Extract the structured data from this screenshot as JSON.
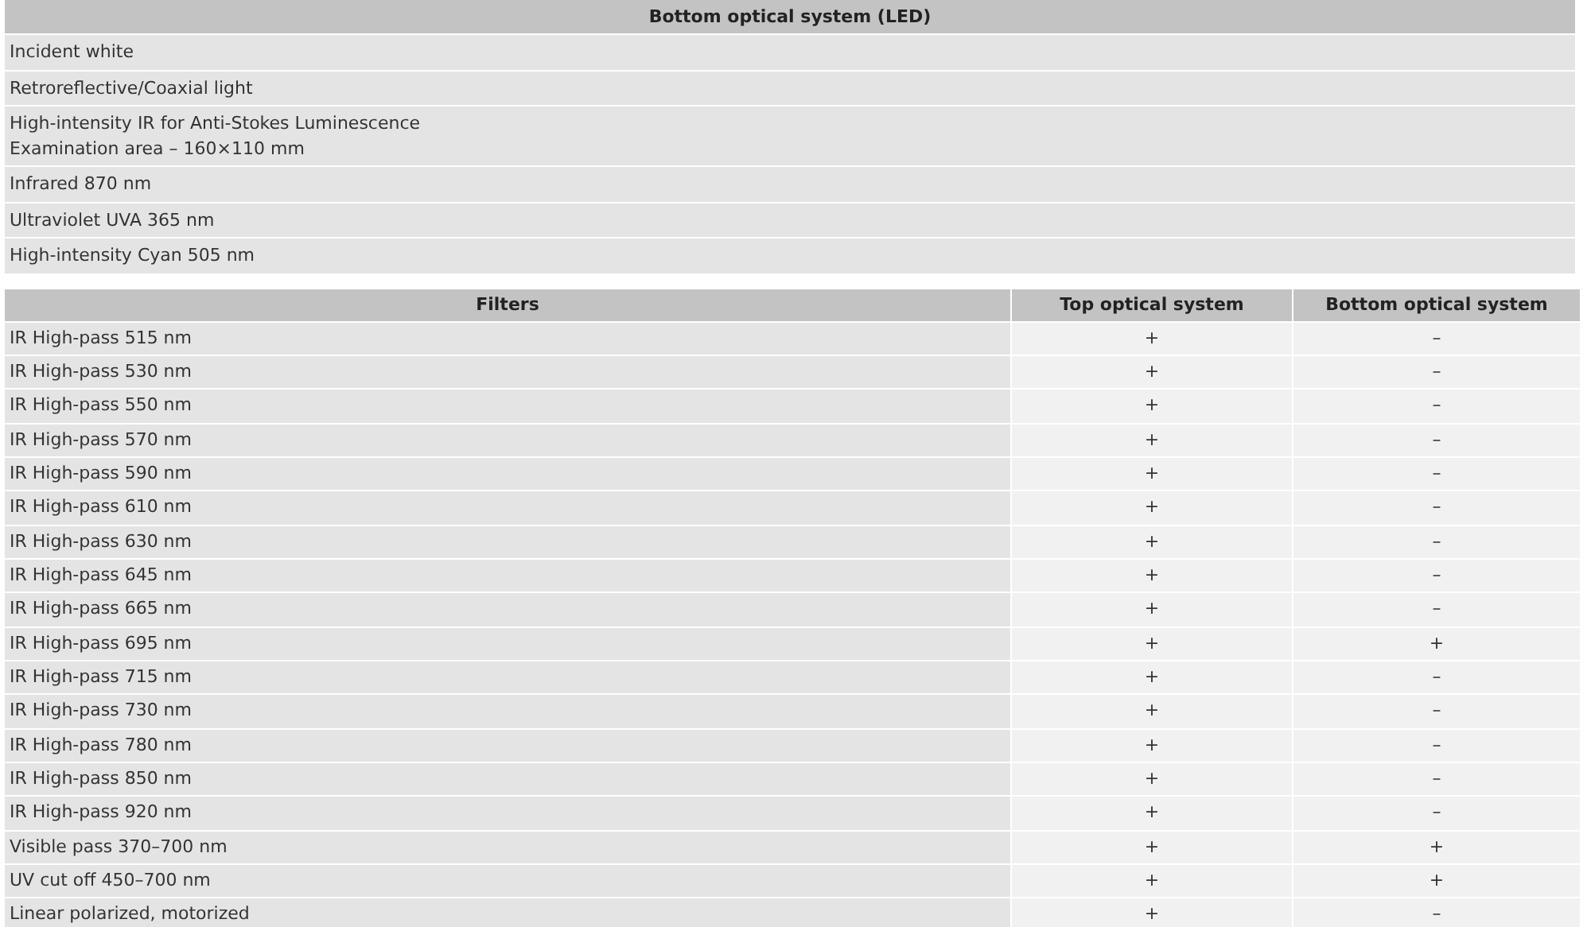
{
  "light_table": {
    "header": "Bottom optical system (LED)",
    "rows": [
      [
        "Incident white"
      ],
      [
        "Retroreflective/Coaxial light"
      ],
      [
        "High-intensity IR for Anti-Stokes Luminescence",
        "Examination area – 160×110 mm"
      ],
      [
        "Infrared 870 nm"
      ],
      [
        "Ultraviolet UVA 365 nm"
      ],
      [
        "High-intensity Cyan 505 nm"
      ]
    ]
  },
  "filters_table": {
    "columns": [
      "Filters",
      "Top optical system",
      "Bottom optical system"
    ],
    "rows": [
      [
        "IR High-pass 515 nm",
        "+",
        "–"
      ],
      [
        "IR High-pass 530 nm",
        "+",
        "–"
      ],
      [
        "IR High-pass 550 nm",
        "+",
        "–"
      ],
      [
        "IR High-pass 570 nm",
        "+",
        "–"
      ],
      [
        "IR High-pass 590 nm",
        "+",
        "–"
      ],
      [
        "IR High-pass 610 nm",
        "+",
        "–"
      ],
      [
        "IR High-pass 630 nm",
        "+",
        "–"
      ],
      [
        "IR High-pass 645 nm",
        "+",
        "–"
      ],
      [
        "IR High-pass 665 nm",
        "+",
        "–"
      ],
      [
        "IR High-pass 695 nm",
        "+",
        "+"
      ],
      [
        "IR High-pass 715 nm",
        "+",
        "–"
      ],
      [
        "IR High-pass 730 nm",
        "+",
        "–"
      ],
      [
        "IR High-pass 780 nm",
        "+",
        "–"
      ],
      [
        "IR High-pass 850 nm",
        "+",
        "–"
      ],
      [
        "IR High-pass 920 nm",
        "+",
        "–"
      ],
      [
        "Visible pass 370–700 nm",
        "+",
        "+"
      ],
      [
        "UV cut off 450–700 nm",
        "+",
        "+"
      ],
      [
        "Linear polarized, motorized",
        "+",
        "–"
      ]
    ]
  }
}
